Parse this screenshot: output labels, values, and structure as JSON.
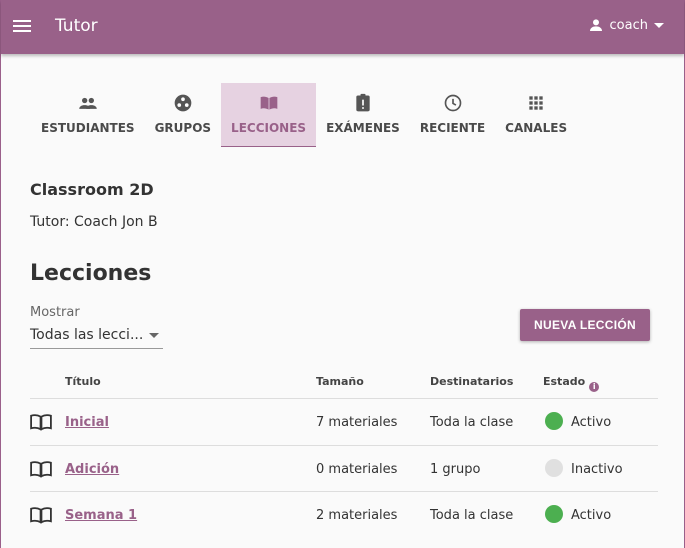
{
  "app": {
    "title": "Tutor",
    "user": "coach"
  },
  "tabs": [
    {
      "label": "ESTUDIANTES",
      "icon": "people-icon"
    },
    {
      "label": "GRUPOS",
      "icon": "groups-icon"
    },
    {
      "label": "LECCIONES",
      "icon": "book-open-icon",
      "active": true
    },
    {
      "label": "EXÁMENES",
      "icon": "clipboard-alert-icon"
    },
    {
      "label": "RECIENTE",
      "icon": "clock-icon"
    },
    {
      "label": "CANALES",
      "icon": "apps-grid-icon"
    }
  ],
  "classroom": {
    "name": "Classroom 2D",
    "coach_line": "Tutor: Coach Jon B"
  },
  "section": {
    "title": "Lecciones"
  },
  "filter": {
    "label": "Mostrar",
    "value": "Todas las lecci..."
  },
  "new_lesson_button": "NUEVA LECCIÓN",
  "table": {
    "headers": {
      "title": "Título",
      "size": "Tamaño",
      "recipients": "Destinatarios",
      "status": "Estado"
    },
    "rows": [
      {
        "title": "Inicial",
        "size": "7 materiales",
        "recipients": "Toda la clase",
        "status": "Activo",
        "active": true
      },
      {
        "title": "Adición",
        "size": "0 materiales",
        "recipients": "1 grupo",
        "status": "Inactivo",
        "active": false
      },
      {
        "title": "Semana 1",
        "size": "2 materiales",
        "recipients": "Toda la clase",
        "status": "Activo",
        "active": true
      }
    ]
  },
  "colors": {
    "brand": "#996189",
    "active_dot": "#4caf50",
    "inactive_dot": "#e0e0e0"
  }
}
